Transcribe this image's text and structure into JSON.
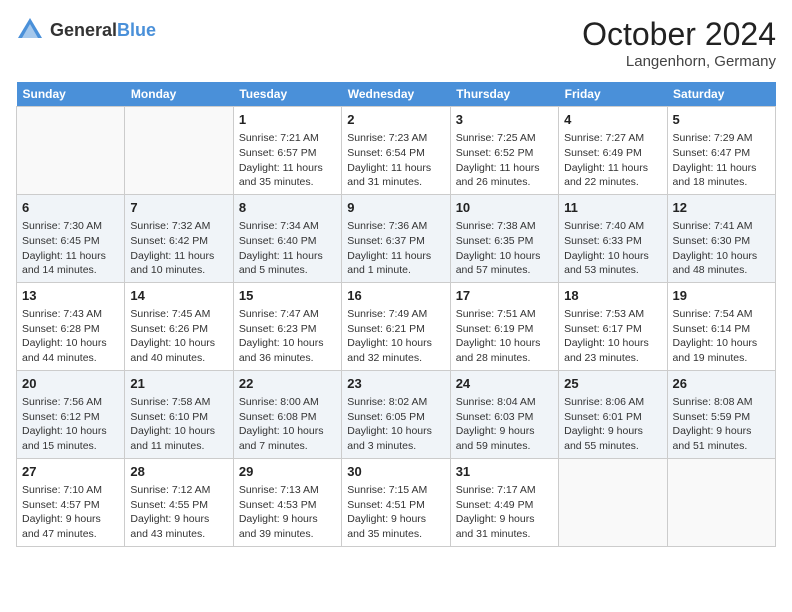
{
  "header": {
    "logo_general": "General",
    "logo_blue": "Blue",
    "month": "October 2024",
    "location": "Langenhorn, Germany"
  },
  "days_of_week": [
    "Sunday",
    "Monday",
    "Tuesday",
    "Wednesday",
    "Thursday",
    "Friday",
    "Saturday"
  ],
  "weeks": [
    [
      {
        "day": "",
        "info": ""
      },
      {
        "day": "",
        "info": ""
      },
      {
        "day": "1",
        "info": "Sunrise: 7:21 AM\nSunset: 6:57 PM\nDaylight: 11 hours and 35 minutes."
      },
      {
        "day": "2",
        "info": "Sunrise: 7:23 AM\nSunset: 6:54 PM\nDaylight: 11 hours and 31 minutes."
      },
      {
        "day": "3",
        "info": "Sunrise: 7:25 AM\nSunset: 6:52 PM\nDaylight: 11 hours and 26 minutes."
      },
      {
        "day": "4",
        "info": "Sunrise: 7:27 AM\nSunset: 6:49 PM\nDaylight: 11 hours and 22 minutes."
      },
      {
        "day": "5",
        "info": "Sunrise: 7:29 AM\nSunset: 6:47 PM\nDaylight: 11 hours and 18 minutes."
      }
    ],
    [
      {
        "day": "6",
        "info": "Sunrise: 7:30 AM\nSunset: 6:45 PM\nDaylight: 11 hours and 14 minutes."
      },
      {
        "day": "7",
        "info": "Sunrise: 7:32 AM\nSunset: 6:42 PM\nDaylight: 11 hours and 10 minutes."
      },
      {
        "day": "8",
        "info": "Sunrise: 7:34 AM\nSunset: 6:40 PM\nDaylight: 11 hours and 5 minutes."
      },
      {
        "day": "9",
        "info": "Sunrise: 7:36 AM\nSunset: 6:37 PM\nDaylight: 11 hours and 1 minute."
      },
      {
        "day": "10",
        "info": "Sunrise: 7:38 AM\nSunset: 6:35 PM\nDaylight: 10 hours and 57 minutes."
      },
      {
        "day": "11",
        "info": "Sunrise: 7:40 AM\nSunset: 6:33 PM\nDaylight: 10 hours and 53 minutes."
      },
      {
        "day": "12",
        "info": "Sunrise: 7:41 AM\nSunset: 6:30 PM\nDaylight: 10 hours and 48 minutes."
      }
    ],
    [
      {
        "day": "13",
        "info": "Sunrise: 7:43 AM\nSunset: 6:28 PM\nDaylight: 10 hours and 44 minutes."
      },
      {
        "day": "14",
        "info": "Sunrise: 7:45 AM\nSunset: 6:26 PM\nDaylight: 10 hours and 40 minutes."
      },
      {
        "day": "15",
        "info": "Sunrise: 7:47 AM\nSunset: 6:23 PM\nDaylight: 10 hours and 36 minutes."
      },
      {
        "day": "16",
        "info": "Sunrise: 7:49 AM\nSunset: 6:21 PM\nDaylight: 10 hours and 32 minutes."
      },
      {
        "day": "17",
        "info": "Sunrise: 7:51 AM\nSunset: 6:19 PM\nDaylight: 10 hours and 28 minutes."
      },
      {
        "day": "18",
        "info": "Sunrise: 7:53 AM\nSunset: 6:17 PM\nDaylight: 10 hours and 23 minutes."
      },
      {
        "day": "19",
        "info": "Sunrise: 7:54 AM\nSunset: 6:14 PM\nDaylight: 10 hours and 19 minutes."
      }
    ],
    [
      {
        "day": "20",
        "info": "Sunrise: 7:56 AM\nSunset: 6:12 PM\nDaylight: 10 hours and 15 minutes."
      },
      {
        "day": "21",
        "info": "Sunrise: 7:58 AM\nSunset: 6:10 PM\nDaylight: 10 hours and 11 minutes."
      },
      {
        "day": "22",
        "info": "Sunrise: 8:00 AM\nSunset: 6:08 PM\nDaylight: 10 hours and 7 minutes."
      },
      {
        "day": "23",
        "info": "Sunrise: 8:02 AM\nSunset: 6:05 PM\nDaylight: 10 hours and 3 minutes."
      },
      {
        "day": "24",
        "info": "Sunrise: 8:04 AM\nSunset: 6:03 PM\nDaylight: 9 hours and 59 minutes."
      },
      {
        "day": "25",
        "info": "Sunrise: 8:06 AM\nSunset: 6:01 PM\nDaylight: 9 hours and 55 minutes."
      },
      {
        "day": "26",
        "info": "Sunrise: 8:08 AM\nSunset: 5:59 PM\nDaylight: 9 hours and 51 minutes."
      }
    ],
    [
      {
        "day": "27",
        "info": "Sunrise: 7:10 AM\nSunset: 4:57 PM\nDaylight: 9 hours and 47 minutes."
      },
      {
        "day": "28",
        "info": "Sunrise: 7:12 AM\nSunset: 4:55 PM\nDaylight: 9 hours and 43 minutes."
      },
      {
        "day": "29",
        "info": "Sunrise: 7:13 AM\nSunset: 4:53 PM\nDaylight: 9 hours and 39 minutes."
      },
      {
        "day": "30",
        "info": "Sunrise: 7:15 AM\nSunset: 4:51 PM\nDaylight: 9 hours and 35 minutes."
      },
      {
        "day": "31",
        "info": "Sunrise: 7:17 AM\nSunset: 4:49 PM\nDaylight: 9 hours and 31 minutes."
      },
      {
        "day": "",
        "info": ""
      },
      {
        "day": "",
        "info": ""
      }
    ]
  ]
}
